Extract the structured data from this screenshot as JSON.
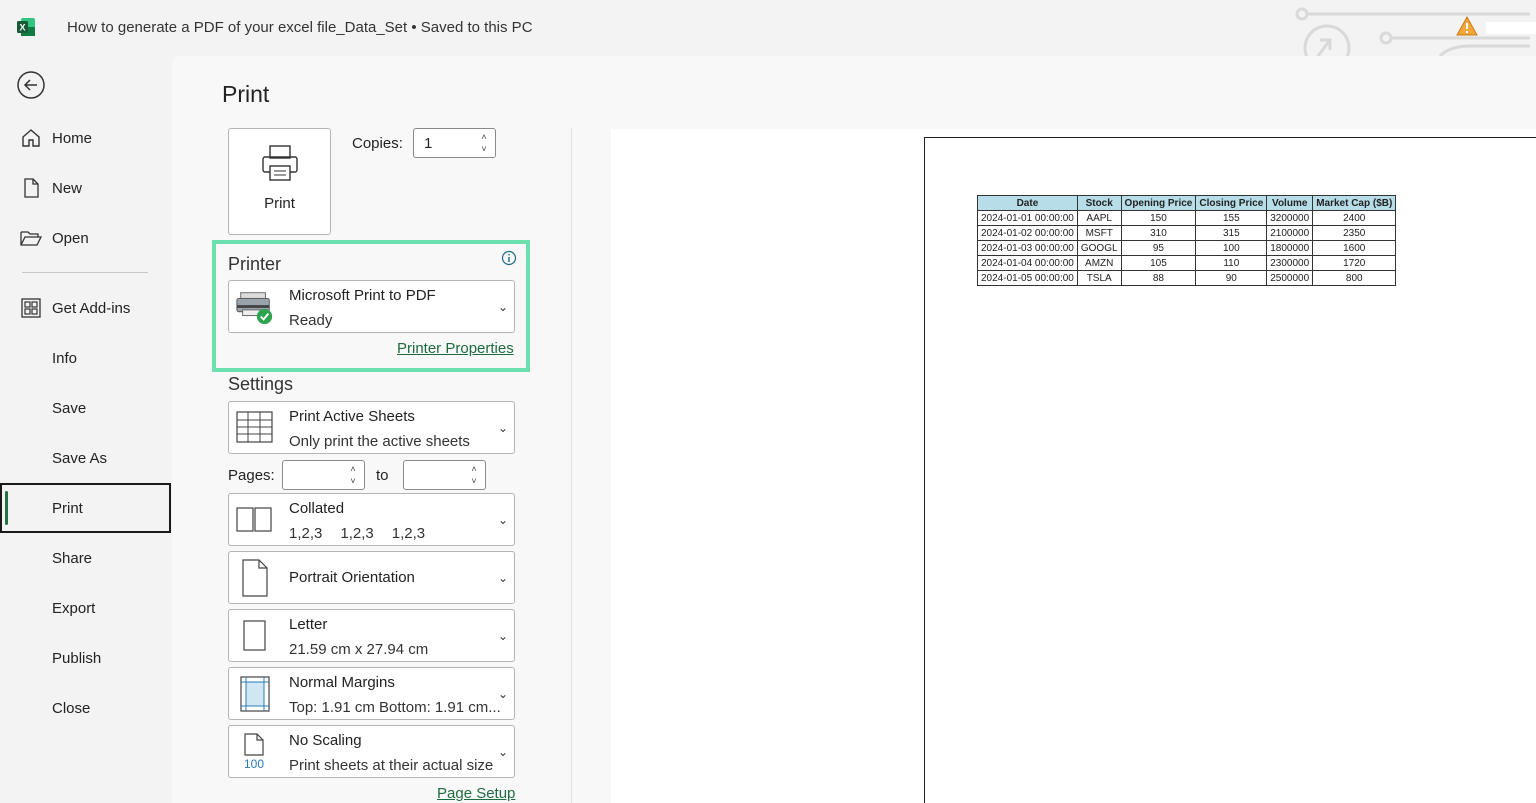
{
  "titlebar": {
    "title": "How to generate a PDF of your excel file_Data_Set",
    "separator": "•",
    "status": "Saved to this PC",
    "accent": "#217346"
  },
  "nav": {
    "items": [
      {
        "label": "Home",
        "icon": "home-icon"
      },
      {
        "label": "New",
        "icon": "new-file-icon"
      },
      {
        "label": "Open",
        "icon": "folder-open-icon"
      },
      {
        "label": "Get Add-ins",
        "icon": "addins-grid-icon"
      },
      {
        "label": "Info"
      },
      {
        "label": "Save"
      },
      {
        "label": "Save As"
      },
      {
        "label": "Print",
        "active": true
      },
      {
        "label": "Share"
      },
      {
        "label": "Export"
      },
      {
        "label": "Publish"
      },
      {
        "label": "Close"
      }
    ]
  },
  "print": {
    "title": "Print",
    "print_button": "Print",
    "copies_label": "Copies:",
    "copies_value": "1",
    "printer_heading": "Printer",
    "printer_name": "Microsoft Print to PDF",
    "printer_status": "Ready",
    "printer_properties": "Printer Properties",
    "settings_heading": "Settings",
    "scope_title": "Print Active Sheets",
    "scope_desc": "Only print the active sheets",
    "pages_label": "Pages:",
    "to_label": "to",
    "collation_title": "Collated",
    "collation_desc": [
      "1,2,3",
      "1,2,3",
      "1,2,3"
    ],
    "orientation": "Portrait Orientation",
    "paper_title": "Letter",
    "paper_desc": "21.59 cm x 27.94 cm",
    "margins_title": "Normal Margins",
    "margins_desc": "Top: 1.91 cm Bottom: 1.91 cm...",
    "scaling_title": "No Scaling",
    "scaling_desc": "Print sheets at their actual size",
    "scaling_icon_text": "100",
    "page_setup": "Page Setup",
    "highlight_color": "#6de0b0"
  },
  "preview_table": {
    "headers": [
      "Date",
      "Stock",
      "Opening Price",
      "Closing Price",
      "Volume",
      "Market Cap ($B)"
    ],
    "rows": [
      [
        "2024-01-01 00:00:00",
        "AAPL",
        "150",
        "155",
        "3200000",
        "2400"
      ],
      [
        "2024-01-02 00:00:00",
        "MSFT",
        "310",
        "315",
        "2100000",
        "2350"
      ],
      [
        "2024-01-03 00:00:00",
        "GOOGL",
        "95",
        "100",
        "1800000",
        "1600"
      ],
      [
        "2024-01-04 00:00:00",
        "AMZN",
        "105",
        "110",
        "2300000",
        "1720"
      ],
      [
        "2024-01-05 00:00:00",
        "TSLA",
        "88",
        "90",
        "2500000",
        "800"
      ]
    ],
    "header_color": "#b7dde8"
  }
}
